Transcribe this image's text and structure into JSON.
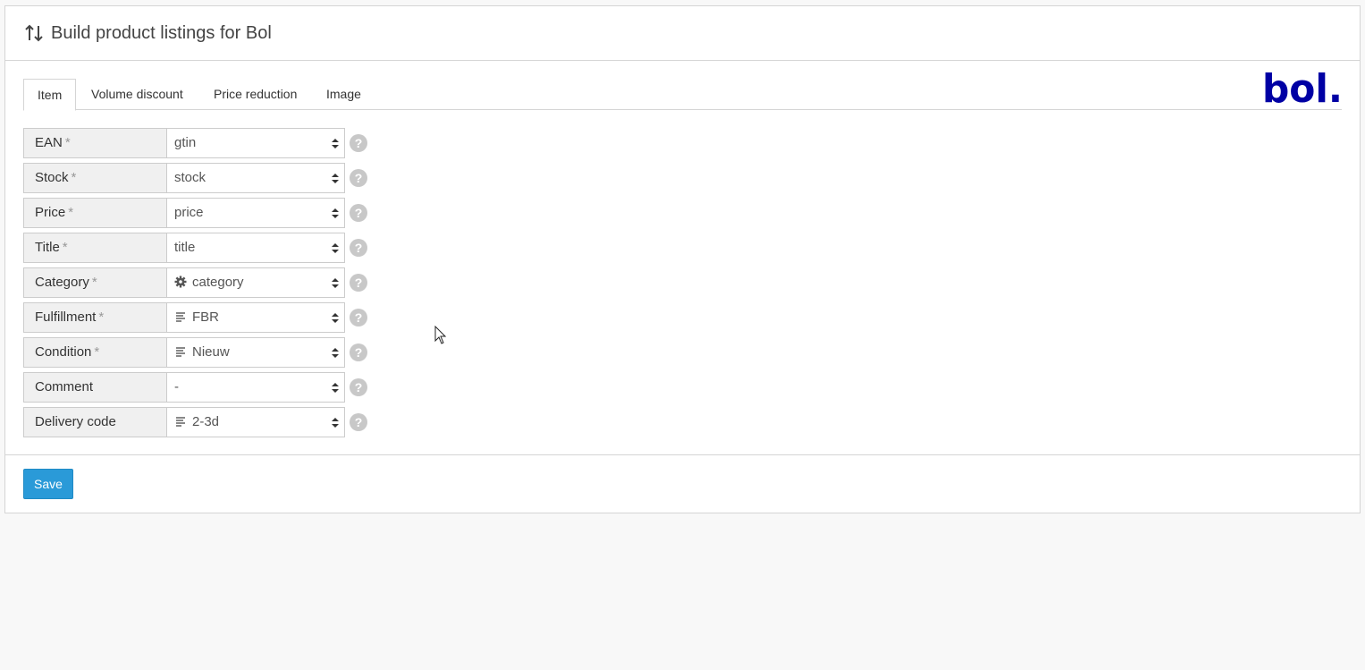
{
  "header": {
    "title": "Build product listings for Bol",
    "icon": "sort-arrows-icon"
  },
  "tabs": [
    {
      "label": "Item",
      "active": true
    },
    {
      "label": "Volume discount",
      "active": false
    },
    {
      "label": "Price reduction",
      "active": false
    },
    {
      "label": "Image",
      "active": false
    }
  ],
  "logo": {
    "text": "bol.",
    "color": "#0000a4"
  },
  "fields": [
    {
      "label": "EAN",
      "required": "*",
      "value": "gtin",
      "icon": ""
    },
    {
      "label": "Stock",
      "required": "*",
      "value": "stock",
      "icon": ""
    },
    {
      "label": "Price",
      "required": "*",
      "value": "price",
      "icon": ""
    },
    {
      "label": "Title",
      "required": "*",
      "value": "title",
      "icon": ""
    },
    {
      "label": "Category",
      "required": "*",
      "value": "category",
      "icon": "gear"
    },
    {
      "label": "Fulfillment",
      "required": "*",
      "value": "FBR",
      "icon": "text-lines"
    },
    {
      "label": "Condition",
      "required": "*",
      "value": "Nieuw",
      "icon": "text-lines"
    },
    {
      "label": "Comment",
      "required": "",
      "value": "-",
      "icon": ""
    },
    {
      "label": "Delivery code",
      "required": "",
      "value": "2-3d",
      "icon": "text-lines"
    }
  ],
  "help_symbol": "?",
  "footer": {
    "save_label": "Save"
  },
  "colors": {
    "accent": "#2a9ad8",
    "brand": "#0000a4"
  }
}
